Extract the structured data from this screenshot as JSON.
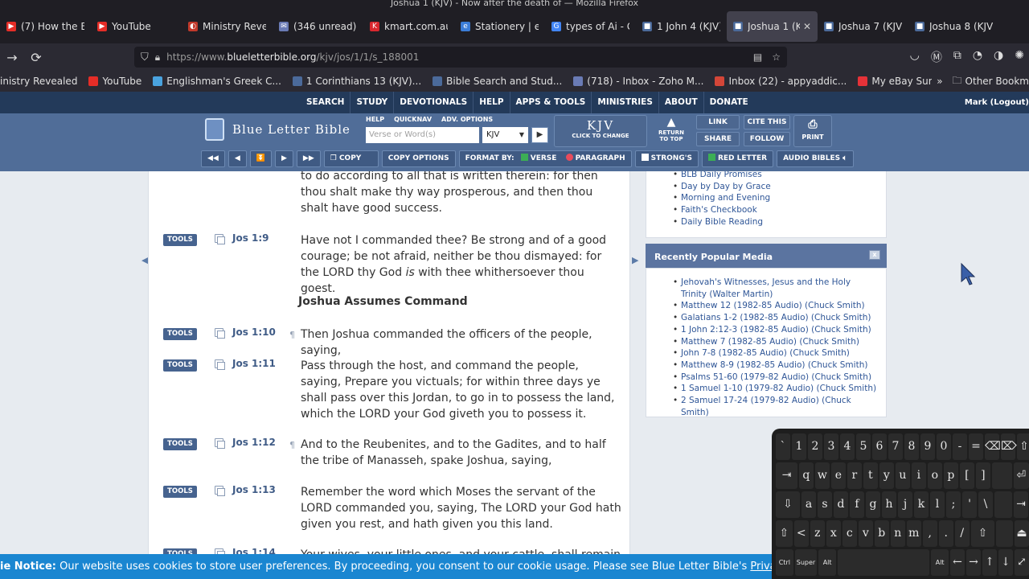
{
  "window_title": "Joshua 1 (KJV) - Now after the death of — Mozilla Firefox",
  "tabs": [
    {
      "label": "(7) How the El",
      "color": "#e52d27",
      "glyph": "▶"
    },
    {
      "label": "YouTube",
      "color": "#e52d27",
      "glyph": "▶"
    },
    {
      "label": "Ministry Reveal",
      "color": "#c0392b",
      "glyph": "◐"
    },
    {
      "label": "(346 unread) -",
      "color": "#6a7bb5",
      "glyph": "✉"
    },
    {
      "label": "kmart.com.au",
      "color": "#d9272e",
      "glyph": "K"
    },
    {
      "label": "Stationery | eB",
      "color": "#3b7dd8",
      "glyph": "e"
    },
    {
      "label": "types of Ai - G",
      "color": "#4285f4",
      "glyph": "G"
    },
    {
      "label": "1 John 4 (KJV)",
      "color": "#4b6a9a",
      "glyph": "■"
    },
    {
      "label": "Joshua 1 (K",
      "color": "#4b6a9a",
      "glyph": "■",
      "active": true
    },
    {
      "label": "Joshua 7 (KJV",
      "color": "#4b6a9a",
      "glyph": "■"
    },
    {
      "label": "Joshua 8 (KJV",
      "color": "#4b6a9a",
      "glyph": "■"
    }
  ],
  "url": {
    "prefix": "https://www.",
    "host": "blueletterbible.org",
    "path": "/kjv/jos/1/1/s_188001"
  },
  "bookmarks": [
    {
      "label": "inistry Revealed",
      "color": ""
    },
    {
      "label": "YouTube",
      "color": "#e52d27"
    },
    {
      "label": "Englishman's Greek C...",
      "color": "#4aa3df"
    },
    {
      "label": "1 Corinthians 13 (KJV)...",
      "color": "#4b6a9a"
    },
    {
      "label": "Bible Search and Stud...",
      "color": "#4b6a9a"
    },
    {
      "label": "(718) - Inbox - Zoho M...",
      "color": "#6a7bb5"
    },
    {
      "label": "Inbox (22) - appyaddic...",
      "color": "#d44638"
    },
    {
      "label": "My eBay Summary",
      "color": "#e53238"
    }
  ],
  "bookmarks_more": "»",
  "other_bookmarks": "Other Bookm",
  "top_menu": [
    "SEARCH",
    "STUDY",
    "DEVOTIONALS",
    "HELP",
    "APPS & TOOLS",
    "MINISTRIES",
    "ABOUT",
    "DONATE"
  ],
  "user_label": "Mark (Logout)",
  "blb": {
    "logo_text": "Blue Letter Bible",
    "search_links": [
      "HELP",
      "QUICKNAV",
      "ADV. OPTIONS"
    ],
    "search_placeholder": "Verse or Word(s)",
    "version": "KJV",
    "kjv_big": "KJV",
    "kjv_small": "CLICK TO CHANGE",
    "return_to_top": "RETURN TO TOP",
    "link": "LINK",
    "share": "SHARE",
    "cite_this": "CITE THIS",
    "follow": "FOLLOW",
    "print": "PRINT"
  },
  "toolbar": {
    "copy": "COPY",
    "copy_options": "COPY OPTIONS",
    "format_by": "FORMAT BY:",
    "verse": "VERSE",
    "paragraph": "PARAGRAPH",
    "strongs": "STRONG'S",
    "red_letter": "RED LETTER",
    "audio_bibles": "AUDIO BIBLES"
  },
  "partial_top_text": "to do according to all that is written therein: for then thou shalt make thy way prosperous, and then thou shalt have good success.",
  "heading": "Joshua Assumes Command",
  "verses": [
    {
      "ref": "Jos 1:9",
      "para": "",
      "text_a": "Have not I commanded thee? Be strong and of a good courage; be not afraid, neither be thou dismayed: for the LORD thy God ",
      "text_italic": "is",
      "text_b": " with thee whithersoever thou goest."
    },
    {
      "ref": "Jos 1:10",
      "para": "¶",
      "text": "Then Joshua commanded the officers of the people, saying,"
    },
    {
      "ref": "Jos 1:11",
      "para": "",
      "text": "Pass through the host, and command the people, saying, Prepare you victuals; for within three days ye shall pass over this Jordan, to go in to possess the land, which the LORD your God giveth you to possess it."
    },
    {
      "ref": "Jos 1:12",
      "para": "¶",
      "text": "And to the Reubenites, and to the Gadites, and to half the tribe of Manasseh, spake Joshua, saying,"
    },
    {
      "ref": "Jos 1:13",
      "para": "",
      "text": "Remember the word which Moses the servant of the LORD commanded you, saying, The LORD your God hath given you rest, and hath given you this land."
    },
    {
      "ref": "Jos 1:14",
      "para": "",
      "text": "Your wives, your little ones, and your cattle, shall remain in the"
    }
  ],
  "tools_label": "TOOLS",
  "devotionals": [
    "BLB Daily Promises",
    "Day by Day by Grace",
    "Morning and Evening",
    "Faith's Checkbook",
    "Daily Bible Reading"
  ],
  "popular_media": {
    "title": "Recently Popular Media",
    "close": "x",
    "items": [
      "Jehovah's Witnesses, Jesus and the Holy Trinity (Walter Martin)",
      "Matthew 12 (1982-85 Audio) (Chuck Smith)",
      "Galatians 1-2 (1982-85 Audio) (Chuck Smith)",
      "1 John 2:12-3 (1982-85 Audio) (Chuck Smith)",
      "Matthew 7 (1982-85 Audio) (Chuck Smith)",
      "John 7-8 (1982-85 Audio) (Chuck Smith)",
      "Matthew 8-9 (1982-85 Audio) (Chuck Smith)",
      "Psalms 51-60 (1979-82 Audio) (Chuck Smith)",
      "1 Samuel 1-10 (1979-82 Audio) (Chuck Smith)",
      "2 Samuel 17-24 (1979-82 Audio) (Chuck Smith)"
    ]
  },
  "cookie": {
    "label": "ie Notice:",
    "text": " Our website uses cookies to store user preferences. By proceeding, you consent to our cookie usage. Please see Blue Letter Bible's ",
    "link": "Privacy Policy",
    "tail": " f"
  },
  "keyboard": {
    "row1": [
      "`",
      "1",
      "2",
      "3",
      "4",
      "5",
      "6",
      "7",
      "8",
      "9",
      "0",
      "-",
      "=",
      "⌫",
      "⌦",
      "⇧"
    ],
    "row2": [
      "⇥",
      "q",
      "w",
      "e",
      "r",
      "t",
      "y",
      "u",
      "i",
      "o",
      "p",
      "[",
      "]",
      "",
      "⏎"
    ],
    "row3": [
      "⇩",
      "a",
      "s",
      "d",
      "f",
      "g",
      "h",
      "j",
      "k",
      "l",
      ";",
      "'",
      "\\",
      "",
      "⇥"
    ],
    "row4": [
      "⇧",
      "<",
      "z",
      "x",
      "c",
      "v",
      "b",
      "n",
      "m",
      ",",
      ".",
      "/",
      "⇧",
      "",
      "⏏"
    ],
    "row5": [
      "Ctrl",
      "Super",
      "Alt",
      "",
      "Alt Gr",
      "←",
      "→",
      "↑",
      "↓",
      "⤢"
    ]
  },
  "colors": {
    "brand_dark": "#233a5a",
    "brand": "#506d98",
    "link": "#2f5697",
    "cookie": "#1a86d1"
  }
}
